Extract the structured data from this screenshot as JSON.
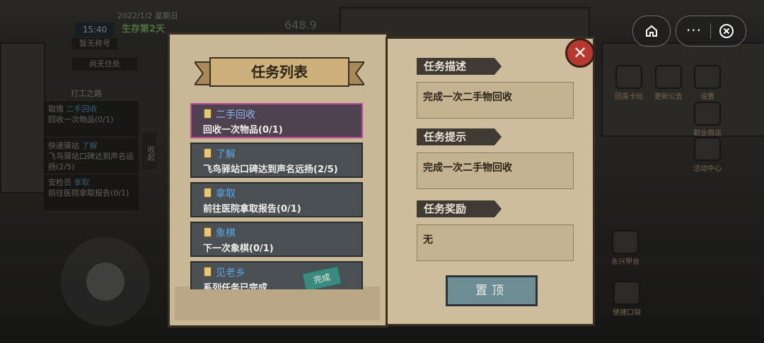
{
  "hud": {
    "time": "15:40",
    "date": "2022/1/2 星期日",
    "survival_day": "生存第2天",
    "money": "648.9",
    "nickname": "暂无称号",
    "home": "尚无住处",
    "work": "打工之路"
  },
  "side_quests": [
    {
      "prefix": "取情",
      "name": "二手回收",
      "desc": "回收一次物品(0/1)"
    },
    {
      "prefix": "快递驿站",
      "name": "了解",
      "desc": "飞鸟驿站口碑达到声名远扬(2/5)"
    },
    {
      "prefix": "安检员",
      "name": "拿取",
      "desc": "前往医院拿取报告(0/1)"
    }
  ],
  "collapse_label": "收起",
  "right_buttons": [
    {
      "label": "回高卡玩"
    },
    {
      "label": "更新公告"
    },
    {
      "label": "设置"
    },
    {
      "label": "职业商店"
    },
    {
      "label": "活动中心"
    },
    {
      "label": "永兴甲台"
    },
    {
      "label": "便捷口袋"
    }
  ],
  "dialog": {
    "title": "任务列表",
    "quests": [
      {
        "name": "二手回收",
        "desc": "回收一次物品(0/1)",
        "selected": true
      },
      {
        "name": "了解",
        "desc": "飞鸟驿站口碑达到声名远扬(2/5)",
        "selected": false
      },
      {
        "name": "拿取",
        "desc": "前往医院拿取报告(0/1)",
        "selected": false
      },
      {
        "name": "象棋",
        "desc": "下一次象棋(0/1)",
        "selected": false
      },
      {
        "name": "见老乡",
        "desc": "系列任务已完成",
        "selected": false,
        "stamp": "完成"
      }
    ],
    "description_label": "任务描述",
    "description": "完成一次二手物回收",
    "hint_label": "任务提示",
    "hint": "完成一次二手物回收",
    "reward_label": "任务奖励",
    "reward": "无",
    "pin_button": "置顶",
    "close_symbol": "✕"
  },
  "capsule": {
    "more_symbol": "···"
  },
  "colors": {
    "selected_border": "#c2499a",
    "quest_name": "#5aa7e6",
    "close_button": "#b5392e",
    "pin_button": "#6e8c94"
  }
}
